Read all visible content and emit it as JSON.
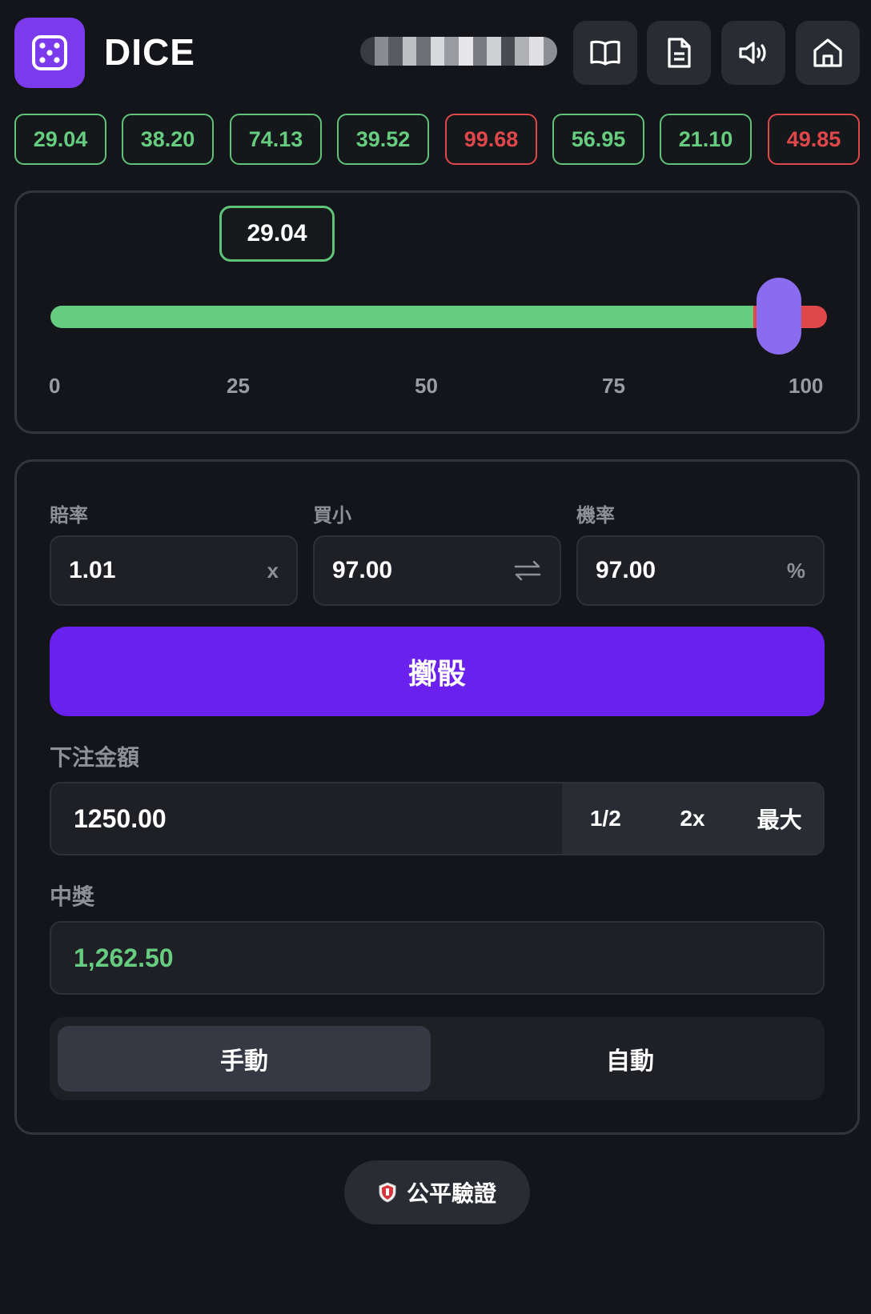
{
  "header": {
    "title": "DICE",
    "icons": [
      "dice-icon",
      "book-icon",
      "document-icon",
      "speaker-icon",
      "home-icon"
    ],
    "logo_color": "#7c3aed"
  },
  "history": [
    {
      "value": "29.04",
      "status": "win"
    },
    {
      "value": "38.20",
      "status": "win"
    },
    {
      "value": "74.13",
      "status": "win"
    },
    {
      "value": "39.52",
      "status": "win"
    },
    {
      "value": "99.68",
      "status": "lose"
    },
    {
      "value": "56.95",
      "status": "win"
    },
    {
      "value": "21.10",
      "status": "win"
    },
    {
      "value": "49.85",
      "status": "lose"
    }
  ],
  "slider": {
    "result": "29.04",
    "ticks": [
      "0",
      "25",
      "50",
      "75",
      "100"
    ],
    "threshold": 97,
    "colors": {
      "win": "#66cc7f",
      "lose": "#e0474a",
      "thumb": "#8b6cf0"
    }
  },
  "bet": {
    "payout_label": "賠率",
    "payout_value": "1.01",
    "payout_suffix": "x",
    "rollunder_label": "買小",
    "rollunder_value": "97.00",
    "chance_label": "機率",
    "chance_value": "97.00",
    "chance_suffix": "%",
    "roll_button": "擲骰",
    "amount_label": "下注金額",
    "amount_value": "1250.00",
    "half_label": "1/2",
    "double_label": "2x",
    "max_label": "最大",
    "win_label": "中獎",
    "win_value": "1,262.50",
    "manual_label": "手動",
    "auto_label": "自動"
  },
  "footer": {
    "fair_label": "公平驗證"
  }
}
